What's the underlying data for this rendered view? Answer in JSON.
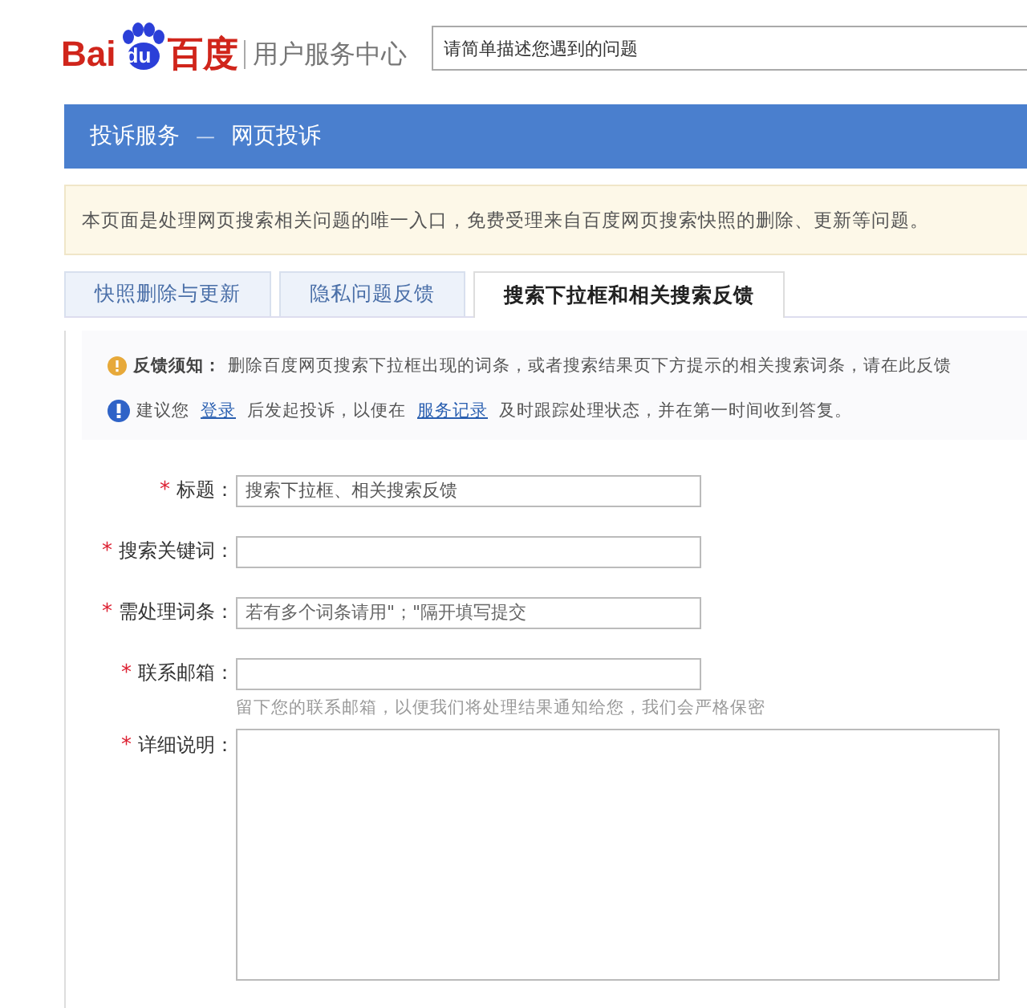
{
  "header": {
    "logo": {
      "left": "Bai",
      "paw": "du",
      "right": "百度"
    },
    "site_title": "用户服务中心",
    "search": {
      "placeholder": "请简单描述您遇到的问题"
    }
  },
  "breadcrumb": [
    "投诉服务",
    "—",
    "网页投诉"
  ],
  "intro": "本页面是处理网页搜索相关问题的唯一入口，免费受理来自百度网页搜索快照的删除、更新等问题。",
  "tabs": [
    {
      "label": "快照删除与更新",
      "selected": false
    },
    {
      "label": "隐私问题反馈",
      "selected": false
    },
    {
      "label": "搜索下拉框和相关搜索反馈",
      "selected": true
    }
  ],
  "notices": [
    {
      "kind": "warning",
      "parts": [
        {
          "kind": "bold",
          "text": "反馈须知："
        },
        {
          "kind": "text",
          "text": "删除百度网页搜索下拉框出现的词条，或者搜索结果页下方提示的相关搜索词条，请在此反馈"
        }
      ]
    },
    {
      "kind": "info",
      "parts": [
        {
          "kind": "text",
          "text": "建议您"
        },
        {
          "kind": "link",
          "text": "登录"
        },
        {
          "kind": "text",
          "text": "后发起投诉，以便在"
        },
        {
          "kind": "link",
          "text": "服务记录"
        },
        {
          "kind": "text",
          "text": "及时跟踪处理状态，并在第一时间收到答复。"
        }
      ]
    }
  ],
  "form": [
    {
      "kind": "input",
      "required": true,
      "label": "标题：",
      "value": "搜索下拉框、相关搜索反馈"
    },
    {
      "kind": "input",
      "required": true,
      "label": "搜索关键词："
    },
    {
      "kind": "input",
      "required": true,
      "label": "需处理词条：",
      "placeholder": "若有多个词条请用\"；\"隔开填写提交"
    },
    {
      "kind": "input",
      "required": true,
      "label": "联系邮箱：",
      "hint": "留下您的联系邮箱，以便我们将处理结果通知给您，我们会严格保密"
    },
    {
      "kind": "textarea",
      "required": true,
      "label": "详细说明："
    }
  ],
  "required_mark": "*"
}
